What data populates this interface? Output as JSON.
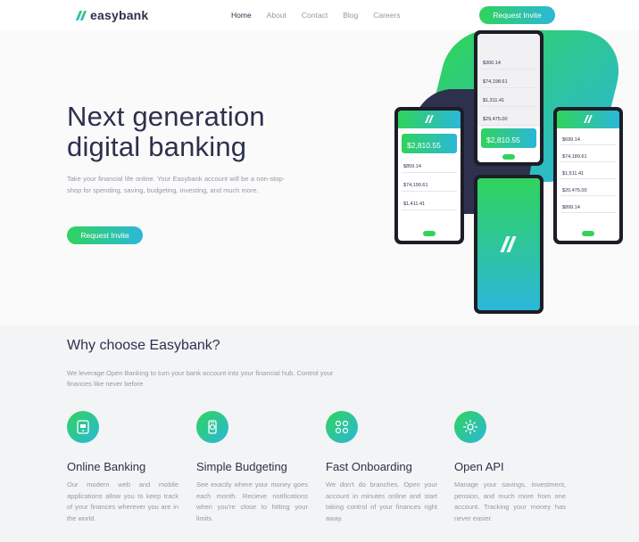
{
  "brand": {
    "name": "easybank",
    "gradient_start": "#31d35c",
    "gradient_end": "#2bb7da",
    "dark": "#2d314d"
  },
  "nav": {
    "items": [
      "Home",
      "About",
      "Contact",
      "Blog",
      "Careers"
    ],
    "cta": "Request Invite"
  },
  "hero": {
    "title_line1": "Next generation",
    "title_line2": "digital banking",
    "text": "Take your financial life online. Your Easybank account will be a non-stop-shop for spending, saving, budgeting, investing, and much more.",
    "cta": "Request Invite"
  },
  "mockups": {
    "top_rows": [
      "$300.14",
      "$74,198.61",
      "$1,311.41",
      "$29,475.00"
    ],
    "left_balance": "$2,810.55",
    "left_rows": [
      "$859.14",
      "$74,190.61",
      "$1,411.41"
    ],
    "center_balance": "$2,810.55",
    "right_rows": [
      "$699.14",
      "$74,189.61",
      "$1,511.41",
      "$20,475.00",
      "$899.14"
    ]
  },
  "why": {
    "title": "Why choose Easybank?",
    "text": "We leverage Open Banking to turn your bank account into your financial hub. Control your finances like never before",
    "features": [
      {
        "icon": "online-banking-icon",
        "title": "Online Banking",
        "text": "Our modern web and mobile applications allow you to keep track of your finances wherever you are in the world."
      },
      {
        "icon": "budgeting-icon",
        "title": "Simple Budgeting",
        "text": "See exactly where your money goes each month. Recieve notifications when you're close to hitting your limits."
      },
      {
        "icon": "onboarding-icon",
        "title": "Fast Onboarding",
        "text": "We don't do branches. Open your account in minutes online and start taking control of your finances right away."
      },
      {
        "icon": "api-icon",
        "title": "Open API",
        "text": "Manage your savings, investment, pension, and much more from one account. Tracking your money has never easier."
      }
    ]
  }
}
